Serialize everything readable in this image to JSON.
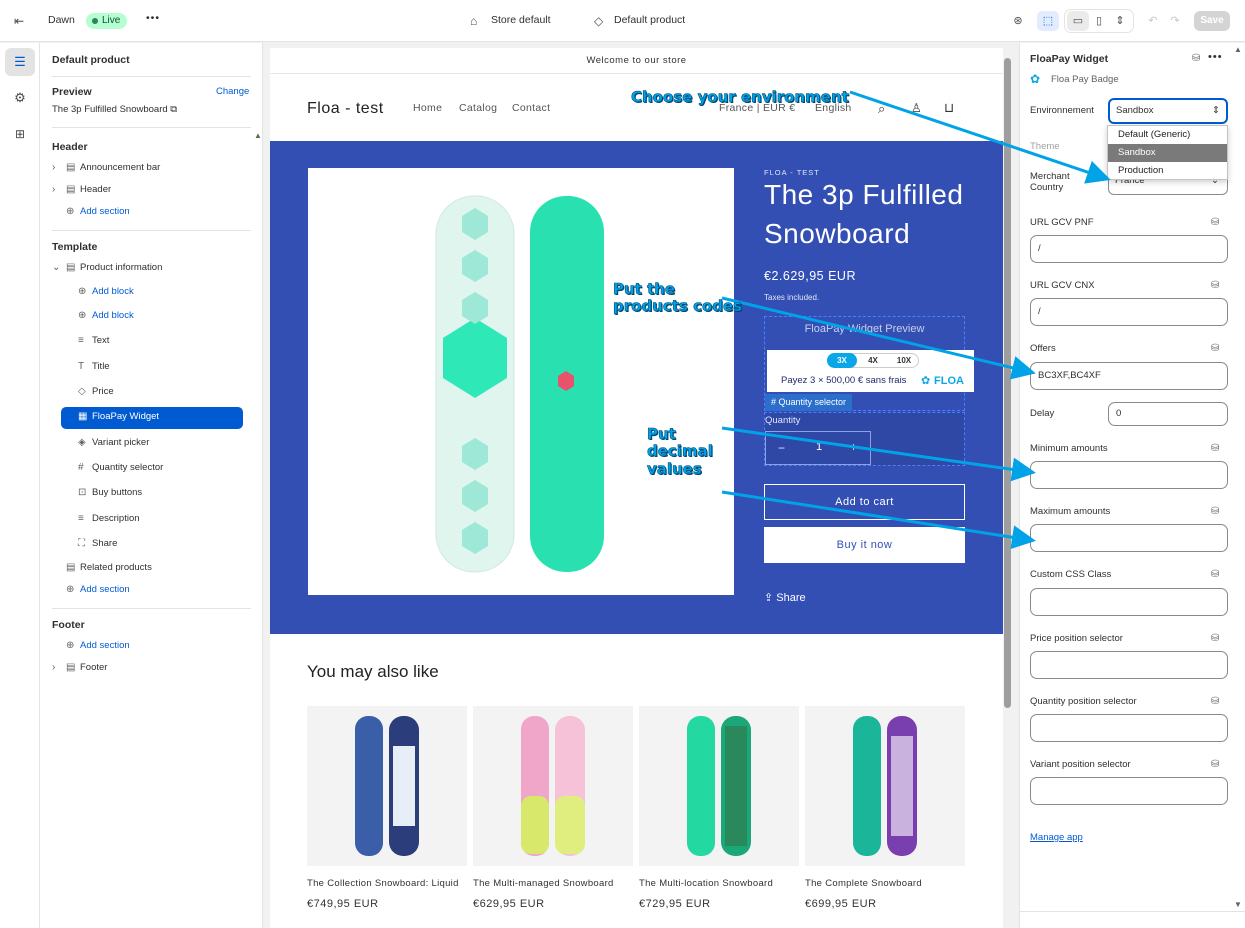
{
  "topbar": {
    "theme_name": "Dawn",
    "live_label": "Live",
    "more_label": "•••",
    "store_label": "Store default",
    "template_label": "Default product",
    "save_label": "Save"
  },
  "left_panel": {
    "title": "Default product",
    "preview_heading": "Preview",
    "change_label": "Change",
    "preview_product": "The 3p Fulfilled Snowboard",
    "header_heading": "Header",
    "header_items": [
      "Announcement bar",
      "Header"
    ],
    "add_section": "Add section",
    "template_heading": "Template",
    "product_information": "Product information",
    "add_block": "Add block",
    "blocks": [
      "Text",
      "Title",
      "Price",
      "FloaPay Widget",
      "Variant picker",
      "Quantity selector",
      "Buy buttons",
      "Description",
      "Share"
    ],
    "related_products": "Related products",
    "footer_heading": "Footer",
    "footer_item": "Footer"
  },
  "preview": {
    "announcement": "Welcome to our store",
    "store_name": "Floa - test",
    "nav": [
      "Home",
      "Catalog",
      "Contact"
    ],
    "currency": "France | EUR €",
    "language": "English",
    "vendor": "FLOA - TEST",
    "product_title_1": "The 3p Fulfilled",
    "product_title_2": "Snowboard",
    "price": "€2.629,95 EUR",
    "taxes": "Taxes included.",
    "widget_preview": "FloaPay Widget Preview",
    "tabs": [
      "3X",
      "4X",
      "10X"
    ],
    "installment_text": "Payez 3 × 500,00 € sans frais",
    "floa_logo": "FLOA",
    "qty_tag": "# Quantity selector",
    "quantity_label": "Quantity",
    "quantity_value": "1",
    "minus": "−",
    "plus": "+",
    "add_to_cart": "Add to cart",
    "buy_now": "Buy it now",
    "share": "Share",
    "also_like": "You may also like",
    "products": [
      {
        "title": "The Collection Snowboard: Liquid",
        "price": "€749,95 EUR"
      },
      {
        "title": "The Multi-managed Snowboard",
        "price": "€629,95 EUR"
      },
      {
        "title": "The Multi-location Snowboard",
        "price": "€729,95 EUR"
      },
      {
        "title": "The Complete Snowboard",
        "price": "€699,95 EUR"
      }
    ]
  },
  "right_panel": {
    "title": "FloaPay Widget",
    "subtitle": "Floa Pay Badge",
    "environment_label": "Environnement",
    "environment_value": "Sandbox",
    "environment_options": [
      "Default (Generic)",
      "Sandbox",
      "Production"
    ],
    "theme_label": "Theme",
    "merchant_label_1": "Merchant",
    "merchant_label_2": "Country",
    "merchant_value": "France",
    "url_pnf_label": "URL GCV PNF",
    "url_pnf_value": "/",
    "url_cnx_label": "URL GCV CNX",
    "url_cnx_value": "/",
    "offers_label": "Offers",
    "offers_value": "BC3XF,BC4XF",
    "delay_label": "Delay",
    "delay_value": "0",
    "min_label": "Minimum amounts",
    "max_label": "Maximum amounts",
    "css_label": "Custom CSS Class",
    "price_sel_label": "Price position selector",
    "qty_sel_label": "Quantity position selector",
    "variant_sel_label": "Variant position selector",
    "manage_app": "Manage app"
  },
  "annotations": {
    "env": "Choose your environment",
    "codes_1": "Put the",
    "codes_2": "products codes",
    "dec_1": "Put",
    "dec_2": "decimal",
    "dec_3": "values"
  },
  "colors": {
    "accent": "#005bd3",
    "hero_bg": "#334fb4",
    "annotation": "#00a3e8",
    "live_bg": "#b4fed2"
  }
}
